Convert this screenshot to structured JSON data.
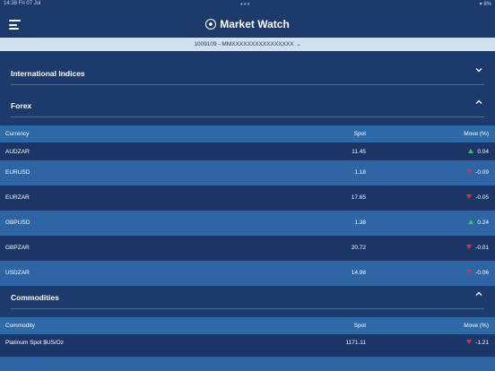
{
  "status_bar": {
    "time": "14:38",
    "date": "Fri 07 Jul",
    "battery": "8%"
  },
  "header": {
    "title": "Market Watch"
  },
  "account": {
    "label": "1009109 - MMXXXXXXXXXXXXXXXX"
  },
  "sections": {
    "international_indices": {
      "label": "International Indices"
    },
    "forex": {
      "label": "Forex",
      "columns": {
        "name": "Currency",
        "spot": "Spot",
        "move": "Move (%)"
      },
      "rows": [
        {
          "name": "AUDZAR",
          "spot": "11.45",
          "move": "0.04",
          "direction": "up"
        },
        {
          "name": "EURUSD",
          "spot": "1.18",
          "move": "-0.09",
          "direction": "down"
        },
        {
          "name": "EURZAR",
          "spot": "17.65",
          "move": "-0.05",
          "direction": "down"
        },
        {
          "name": "GBPUSD",
          "spot": "1.38",
          "move": "0.24",
          "direction": "up"
        },
        {
          "name": "GBPZAR",
          "spot": "20.72",
          "move": "-0.01",
          "direction": "down"
        },
        {
          "name": "USDZAR",
          "spot": "14.98",
          "move": "-0.06",
          "direction": "down"
        }
      ]
    },
    "commodities": {
      "label": "Commodities",
      "columns": {
        "name": "Commodity",
        "spot": "Spot",
        "move": "Move (%)"
      },
      "rows": [
        {
          "name": "Platinum Spot $US/Oz",
          "spot": "1171.11",
          "move": "-1.21",
          "direction": "down"
        }
      ]
    }
  },
  "colors": {
    "background": "#1d3a6c",
    "row_light": "#2e65a4",
    "up": "#3ec15a",
    "down": "#e1323b",
    "account_bar": "#cfe0ee"
  }
}
